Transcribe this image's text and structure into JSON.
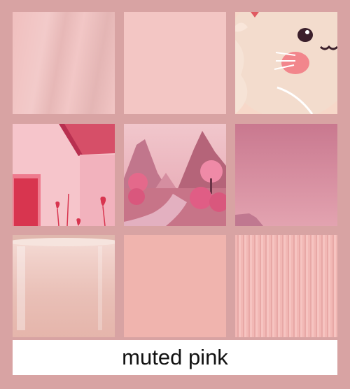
{
  "caption": "muted pink",
  "colors": {
    "background": "#d8a3a3",
    "swatch_fabric": "#f0bfbe",
    "swatch_flat": "#f3c6c4",
    "swatch_peach": "#f0b4ae"
  },
  "tiles": [
    {
      "subject": "fabric"
    },
    {
      "subject": "flat-swatch"
    },
    {
      "subject": "cartoon-cat"
    },
    {
      "subject": "pink-house-with-hearts"
    },
    {
      "subject": "pink-mountain-landscape"
    },
    {
      "subject": "pink-gradient"
    },
    {
      "subject": "ceramic-cup"
    },
    {
      "subject": "peach-swatch"
    },
    {
      "subject": "striped-texture"
    }
  ]
}
